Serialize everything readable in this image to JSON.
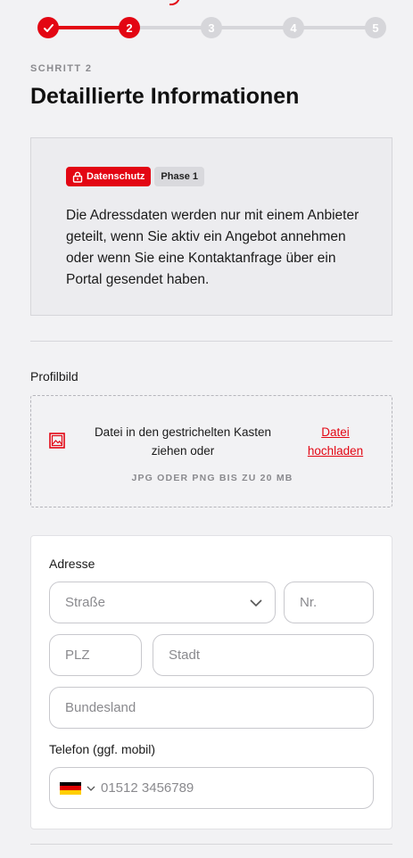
{
  "colors": {
    "accent": "#e30613",
    "inactive_step": "#d6d6da",
    "background": "#f2f2f4"
  },
  "stepper": {
    "steps": [
      {
        "label": "",
        "state": "done",
        "icon": "check-icon"
      },
      {
        "label": "2",
        "state": "active"
      },
      {
        "label": "3",
        "state": "inactive"
      },
      {
        "label": "4",
        "state": "inactive"
      },
      {
        "label": "5",
        "state": "inactive"
      }
    ]
  },
  "header": {
    "step_label": "SCHRITT 2",
    "title": "Detaillierte Informationen"
  },
  "info": {
    "badge_privacy": "Datenschutz",
    "badge_privacy_icon": "lock-icon",
    "badge_phase": "Phase 1",
    "text": "Die Adressdaten werden nur mit einem Anbieter geteilt, wenn Sie aktiv ein Angebot annehmen oder wenn Sie eine Kontaktanfrage über ein Portal gesendet haben."
  },
  "profile": {
    "label": "Profilbild",
    "upload_icon": "image-icon",
    "drop_text": "Datei in den gestrichelten Kasten ziehen oder",
    "upload_link": "Datei hochladen",
    "hint": "JPG ODER PNG BIS ZU 20 MB"
  },
  "address": {
    "label": "Adresse",
    "street_placeholder": "Straße",
    "number_placeholder": "Nr.",
    "zip_placeholder": "PLZ",
    "city_placeholder": "Stadt",
    "state_placeholder": "Bundesland"
  },
  "phone": {
    "label": "Telefon (ggf. mobil)",
    "country_flag": "germany-flag-icon",
    "placeholder": "01512 3456789"
  }
}
